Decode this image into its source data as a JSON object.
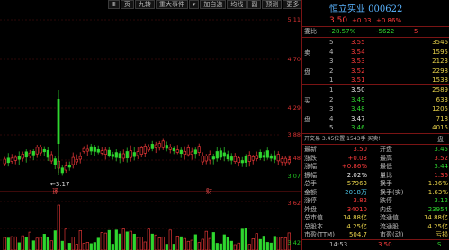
{
  "toolbar": {
    "buttons": [
      "Ⅲ",
      "页",
      "九转",
      "重大事件",
      "",
      "加自选",
      "均线",
      "副",
      "预测",
      "更多"
    ]
  },
  "chart": {
    "price_ticks": [
      {
        "label": "5.11",
        "color": "red"
      },
      {
        "label": "4.70",
        "color": "red"
      },
      {
        "label": "4.29",
        "color": "red"
      },
      {
        "label": "3.88",
        "color": "red"
      },
      {
        "label": "3.48",
        "color": "red"
      },
      {
        "label": "3.07",
        "color": "green"
      },
      {
        "label": "3.62",
        "color": "red"
      },
      {
        "label": "3.42",
        "color": "green"
      }
    ],
    "low_annotation": "3.17",
    "markers": [
      "孫",
      "财"
    ]
  },
  "panel": {
    "title": "恒立实业 000622",
    "price": "3.50",
    "change": "+0.03",
    "change_pct": "+0.86%",
    "weibi_label": "委比",
    "weibi": "-28.57%",
    "weicha": "-5622",
    "weicha_right": "5",
    "sell_label": "卖",
    "buy_label": "买",
    "pan_label": "盘",
    "sell": [
      {
        "lvl": "5",
        "price": "3.55",
        "vol": "3546"
      },
      {
        "lvl": "4",
        "price": "3.54",
        "vol": "1595"
      },
      {
        "lvl": "3",
        "price": "3.53",
        "vol": "2123"
      },
      {
        "lvl": "2",
        "price": "3.52",
        "vol": "2298"
      },
      {
        "lvl": "1",
        "price": "3.51",
        "vol": "1538"
      }
    ],
    "buy": [
      {
        "lvl": "1",
        "price": "3.50",
        "vol": "2589"
      },
      {
        "lvl": "2",
        "price": "3.49",
        "vol": "633"
      },
      {
        "lvl": "3",
        "price": "3.48",
        "vol": "1205"
      },
      {
        "lvl": "4",
        "price": "3.47",
        "vol": "718"
      },
      {
        "lvl": "5",
        "price": "3.46",
        "vol": "4015"
      }
    ],
    "info_line": "开交易 3.45位置 1543手 买卖!",
    "info_right": "盘",
    "stats": [
      {
        "l1": "最新",
        "v1": "3.50",
        "l2": "开盘",
        "v2": "3.45",
        "c1": "red",
        "c2": "grn"
      },
      {
        "l1": "涨跌",
        "v1": "+0.03",
        "l2": "最高",
        "v2": "3.52",
        "c1": "red",
        "c2": "red"
      },
      {
        "l1": "涨幅",
        "v1": "+0.86%",
        "l2": "最低",
        "v2": "3.44",
        "c1": "red",
        "c2": "grn"
      },
      {
        "l1": "振幅",
        "v1": "2.02%",
        "l2": "量比",
        "v2": "1.36",
        "c1": "wht",
        "c2": "red"
      },
      {
        "l1": "总手",
        "v1": "57963",
        "l2": "换手",
        "v2": "1.36%",
        "c1": "yel",
        "c2": "yel"
      },
      {
        "l1": "金额",
        "v1": "2018万",
        "l2": "换手(实)",
        "v2": "1.63%",
        "c1": "cyan",
        "c2": "yel"
      },
      {
        "l1": "涨停",
        "v1": "3.82",
        "l2": "跌停",
        "v2": "3.12",
        "c1": "red",
        "c2": "grn"
      },
      {
        "l1": "外盘",
        "v1": "34010",
        "l2": "内盘",
        "v2": "23954",
        "c1": "red",
        "c2": "grn"
      },
      {
        "l1": "总市值",
        "v1": "14.88亿",
        "l2": "流通值",
        "v2": "14.88亿",
        "c1": "yel",
        "c2": "yel"
      },
      {
        "l1": "总股本",
        "v1": "4.25亿",
        "l2": "流通股",
        "v2": "4.25亿",
        "c1": "yel",
        "c2": "yel"
      },
      {
        "l1": "市盈(TTM)",
        "v1": "504.7",
        "l2": "市盈(动)",
        "v2": "亏损",
        "c1": "yel",
        "c2": "yel"
      }
    ],
    "tick": {
      "time": "14:53",
      "price": "3.50",
      "vol": "",
      "dir": "S"
    },
    "tick_label": "S"
  }
}
